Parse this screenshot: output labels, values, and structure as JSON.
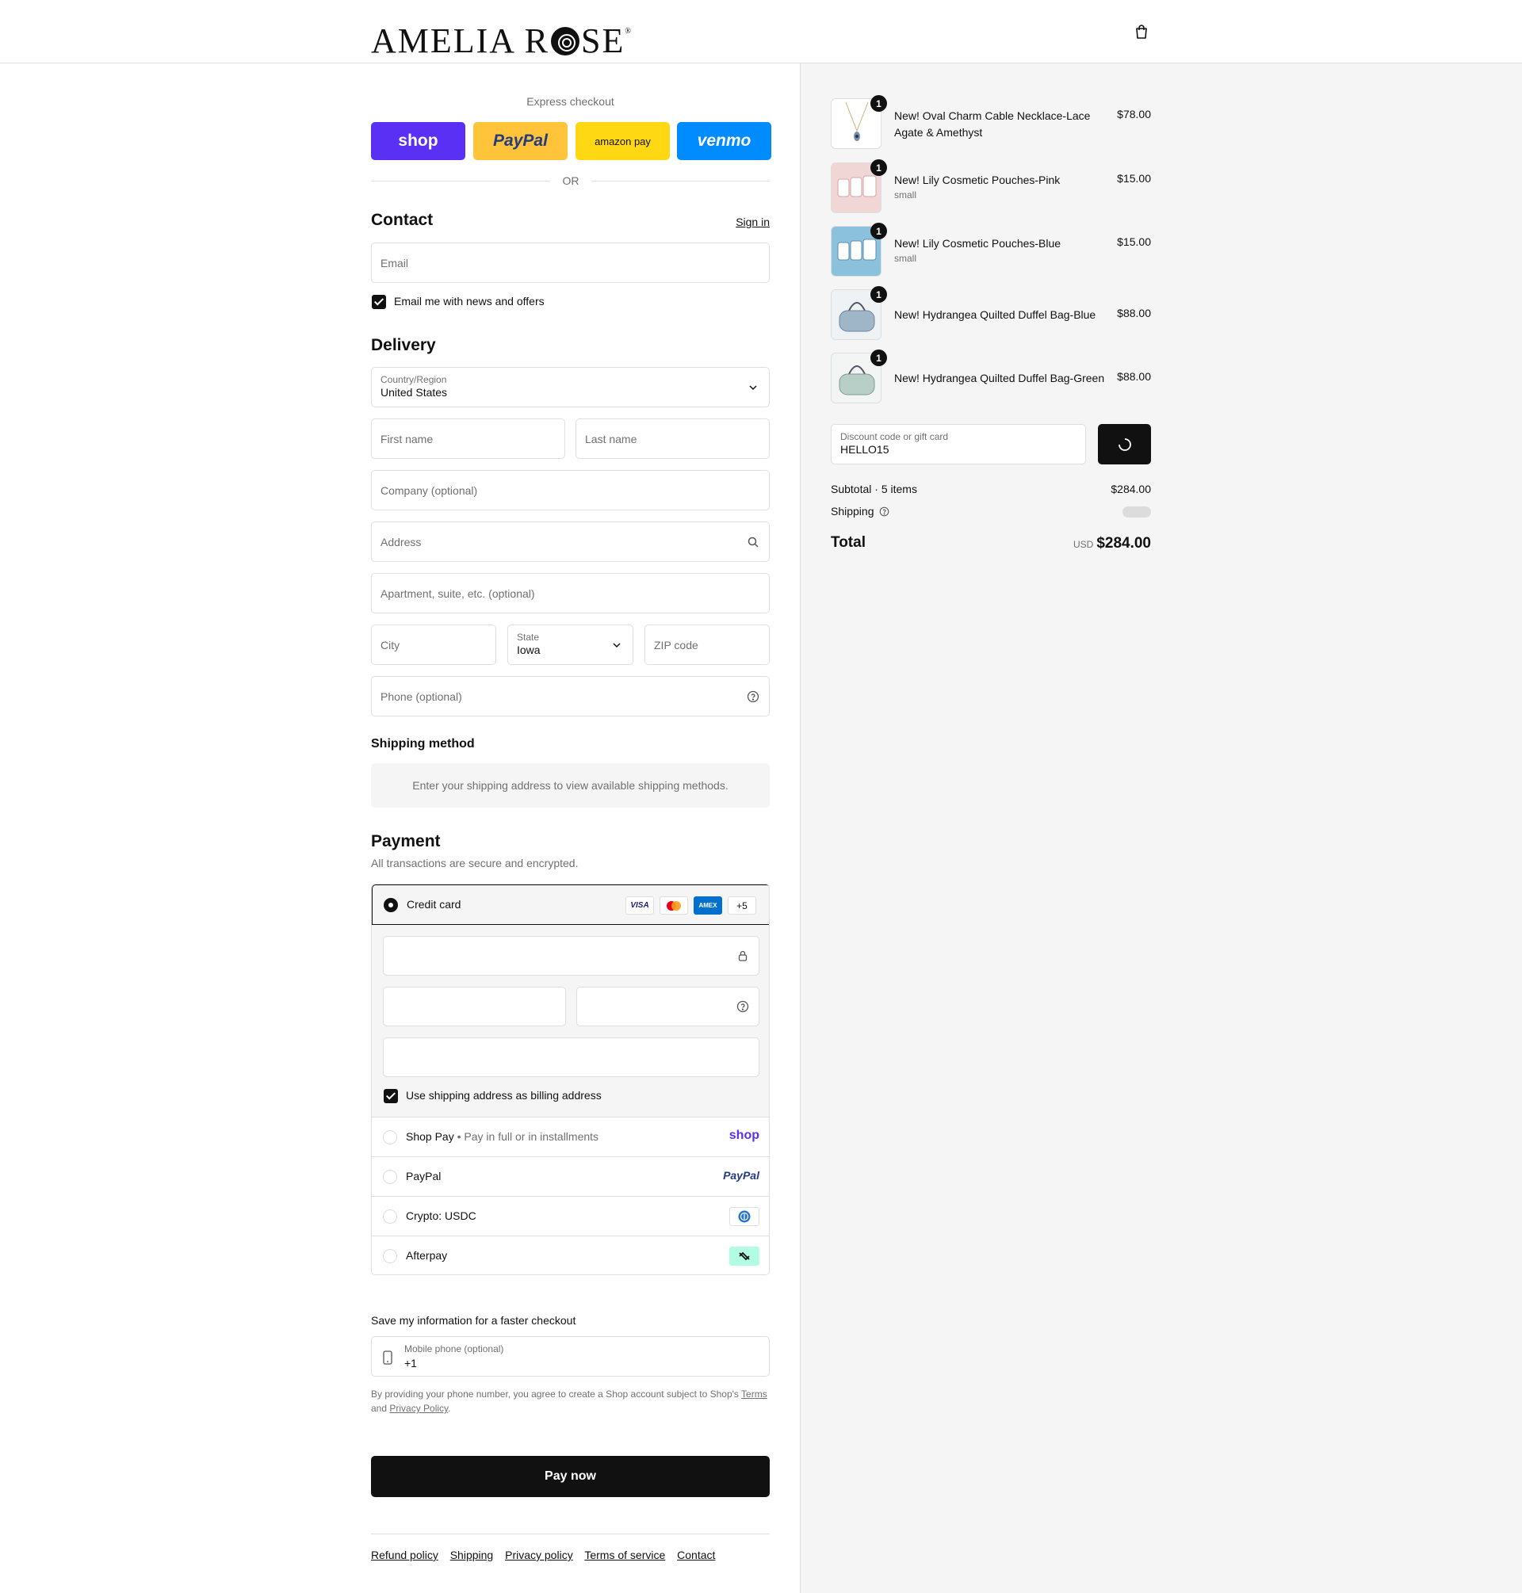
{
  "header": {
    "brand": "AMELIA ROSE",
    "brand_reg": "®",
    "cart_icon": "bag-icon"
  },
  "express": {
    "label": "Express checkout",
    "buttons": [
      {
        "label": "shop",
        "bg": "#5a31f4",
        "fg": "#ffffff"
      },
      {
        "label": "PayPal",
        "bg": "#ffc439",
        "fg": "#253b80"
      },
      {
        "label": "amazon pay",
        "bg": "#ffd814",
        "fg": "#111111"
      },
      {
        "label": "venmo",
        "bg": "#008cff",
        "fg": "#ffffff"
      }
    ],
    "or": "OR"
  },
  "contact": {
    "title": "Contact",
    "sign_in": "Sign in",
    "email_placeholder": "Email",
    "news_checkbox_label": "Email me with news and offers",
    "news_checked": true
  },
  "delivery": {
    "title": "Delivery",
    "country_label": "Country/Region",
    "country_value": "United States",
    "first_name": "First name",
    "last_name": "Last name",
    "company": "Company (optional)",
    "address": "Address",
    "apartment": "Apartment, suite, etc. (optional)",
    "city": "City",
    "state_label": "State",
    "state_value": "Iowa",
    "zip": "ZIP code",
    "phone": "Phone (optional)"
  },
  "shipping_method": {
    "title": "Shipping method",
    "message": "Enter your shipping address to view available shipping methods."
  },
  "payment": {
    "title": "Payment",
    "subtitle": "All transactions are secure and encrypted.",
    "credit_card_label": "Credit card",
    "card_logos": [
      "VISA",
      "mastercard",
      "AMEX",
      "+5"
    ],
    "billing_checkbox_label": "Use shipping address as billing address",
    "billing_checked": true,
    "options": [
      {
        "label": "Shop Pay",
        "sub": "Pay in full or in installments",
        "logo": "shop"
      },
      {
        "label": "PayPal",
        "sub": "",
        "logo": "PayPal"
      },
      {
        "label": "Crypto: USDC",
        "sub": "",
        "logo": "usdc-icon"
      },
      {
        "label": "Afterpay",
        "sub": "",
        "logo": "afterpay-icon"
      }
    ]
  },
  "save_info": {
    "title": "Save my information for a faster checkout",
    "mobile_label": "Mobile phone (optional)",
    "mobile_value": "+1",
    "disclaimer_pre": "By providing your phone number, you agree to create a Shop account subject to Shop's",
    "terms": "Terms",
    "and": "and",
    "privacy": "Privacy Policy",
    "period": "."
  },
  "pay_now": "Pay now",
  "footer": [
    "Refund policy",
    "Shipping",
    "Privacy policy",
    "Terms of service",
    "Contact"
  ],
  "order": {
    "items": [
      {
        "name": "New! Oval Charm Cable Necklace-Lace Agate & Amethyst",
        "variant": "",
        "price": "$78.00",
        "qty": "1"
      },
      {
        "name": "New! Lily Cosmetic Pouches-Pink",
        "variant": "small",
        "price": "$15.00",
        "qty": "1"
      },
      {
        "name": "New! Lily Cosmetic Pouches-Blue",
        "variant": "small",
        "price": "$15.00",
        "qty": "1"
      },
      {
        "name": "New! Hydrangea Quilted Duffel Bag-Blue",
        "variant": "",
        "price": "$88.00",
        "qty": "1"
      },
      {
        "name": "New! Hydrangea Quilted Duffel Bag-Green",
        "variant": "",
        "price": "$88.00",
        "qty": "1"
      }
    ],
    "discount_label": "Discount code or gift card",
    "discount_value": "HELLO15",
    "subtotal_label": "Subtotal · 5 items",
    "subtotal_value": "$284.00",
    "shipping_label": "Shipping",
    "total_label": "Total",
    "currency": "USD",
    "total_value": "$284.00"
  }
}
